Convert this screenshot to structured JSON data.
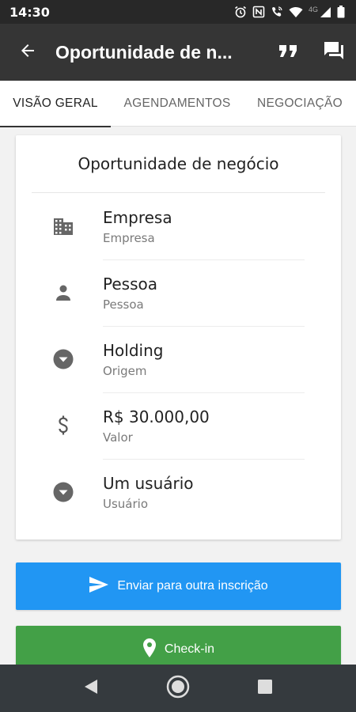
{
  "status_bar": {
    "time": "14:30",
    "network": "4G",
    "icons": [
      "alarm-icon",
      "nfc-icon",
      "call-wifi-icon",
      "wifi-icon",
      "signal-icon",
      "battery-icon"
    ]
  },
  "app_bar": {
    "title": "Oportunidade de n...",
    "back_icon": "arrow-back-icon",
    "actions": [
      "quote-icon",
      "chat-icon"
    ]
  },
  "tabs": [
    {
      "label": "VISÃO GERAL",
      "active": true
    },
    {
      "label": "AGENDAMENTOS",
      "active": false
    },
    {
      "label": "NEGOCIAÇÃO",
      "active": false
    }
  ],
  "card": {
    "title": "Oportunidade de negócio",
    "fields": [
      {
        "icon": "building-icon",
        "value": "Empresa",
        "label": "Empresa"
      },
      {
        "icon": "person-icon",
        "value": "Pessoa",
        "label": "Pessoa"
      },
      {
        "icon": "dropdown-circle-icon",
        "value": "Holding",
        "label": "Origem"
      },
      {
        "icon": "dollar-icon",
        "value": "R$ 30.000,00",
        "label": "Valor"
      },
      {
        "icon": "dropdown-circle-icon",
        "value": "Um usuário",
        "label": "Usuário"
      }
    ]
  },
  "buttons": {
    "send_label": "Enviar para outra inscrição",
    "checkin_label": "Check-in"
  },
  "colors": {
    "status_bar": "#282828",
    "app_bar": "#353535",
    "send_button": "#2196f3",
    "checkin_button": "#43a047",
    "nav_bar": "#353a3e"
  },
  "nav_bar": [
    "back-nav-icon",
    "home-nav-icon",
    "recents-nav-icon"
  ]
}
